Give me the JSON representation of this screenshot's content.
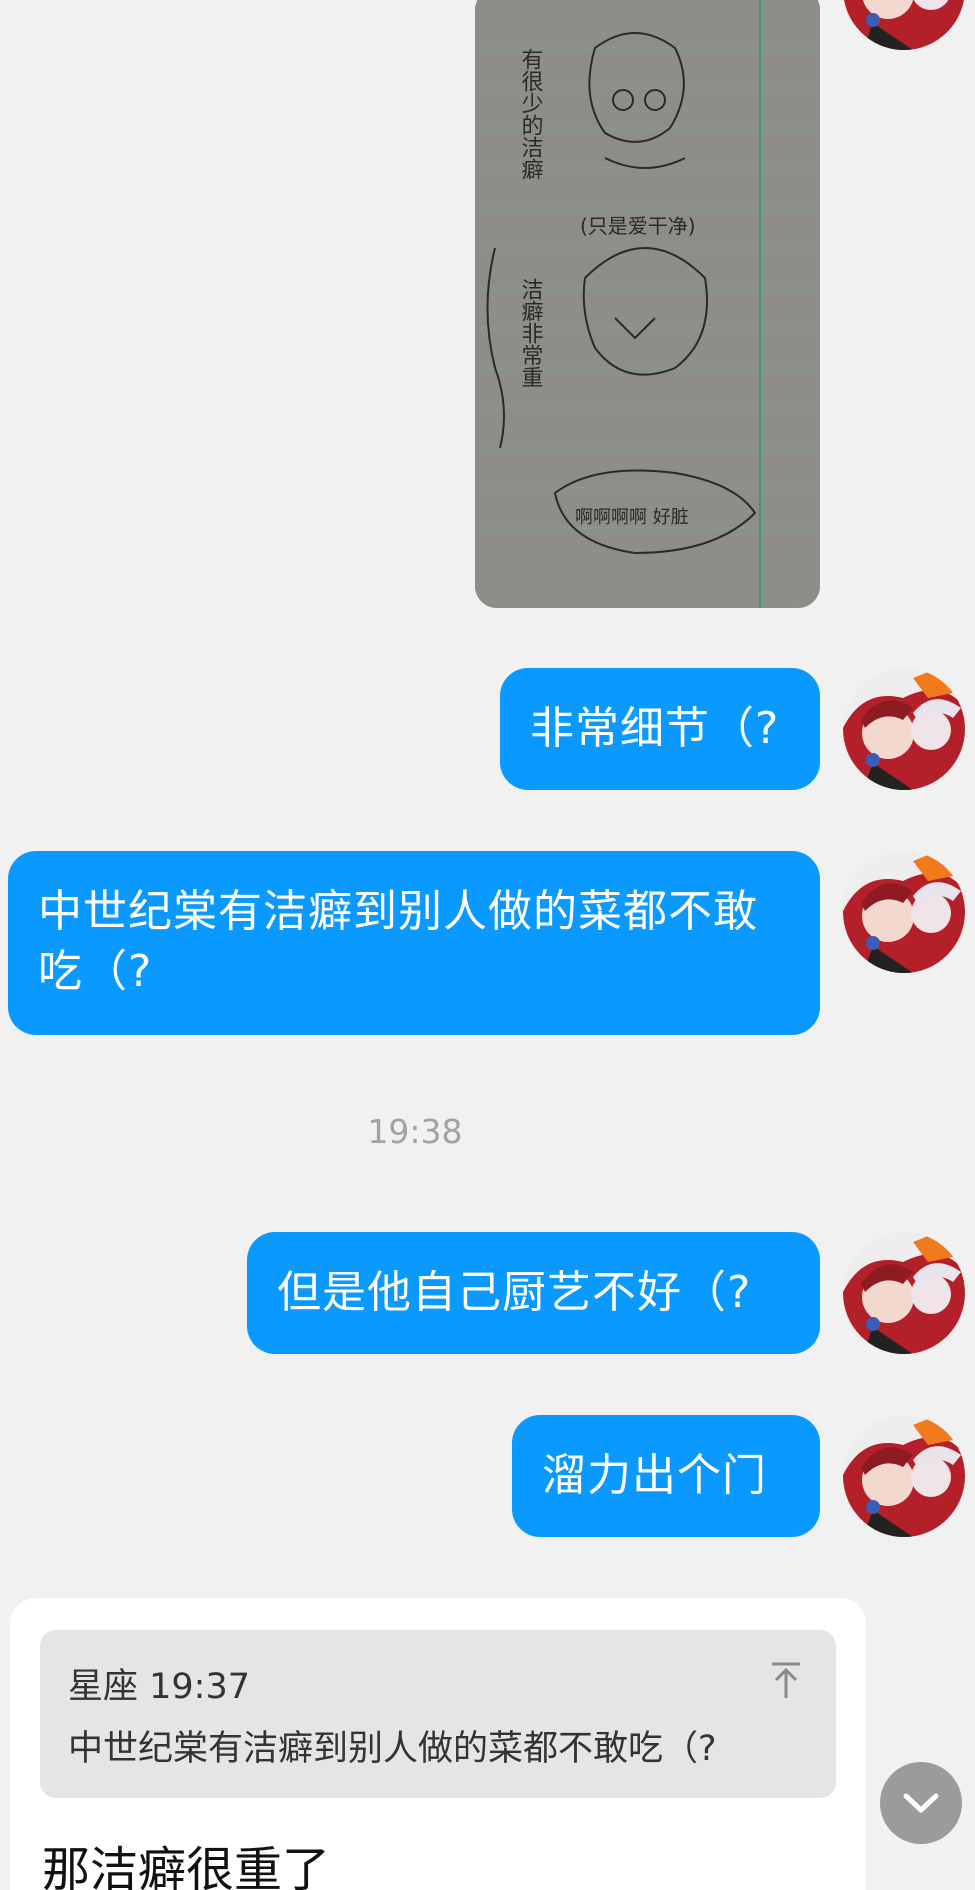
{
  "messages": [
    {
      "id": "m1",
      "type": "image",
      "side": "right",
      "description_icon": "sketch-photo"
    },
    {
      "id": "m2",
      "type": "text",
      "side": "right",
      "text": "非常细节（?"
    },
    {
      "id": "m3",
      "type": "text",
      "side": "right",
      "text": "中世纪棠有洁癖到别人做的菜都不敢吃（?"
    },
    {
      "id": "m4",
      "type": "text",
      "side": "right",
      "text": "但是他自己厨艺不好（?"
    },
    {
      "id": "m5",
      "type": "text",
      "side": "right",
      "text": "溜力出个门"
    }
  ],
  "timestamp": "19:38",
  "reply": {
    "quote_author_time": "星座 19:37",
    "quote_text": "中世纪棠有洁癖到别人做的菜都不敢吃（?",
    "text": "那洁癖很重了"
  },
  "photo_text": {
    "line1": "有很少的洁癖",
    "note": "(只是爱干净)",
    "line2": "洁癖非常重",
    "bubble": "啊啊啊啊 好脏"
  },
  "colors": {
    "background": "#f1f1f1",
    "bubble": "#0a99ff",
    "bubble_text": "#ffffff",
    "card": "#ffffff",
    "quote_bg": "#e5e5e5",
    "timestamp": "#a2a2a2"
  },
  "icons": {
    "pin": "pin-to-top-icon",
    "scroll": "chevron-down-icon",
    "avatar": "avatar"
  }
}
